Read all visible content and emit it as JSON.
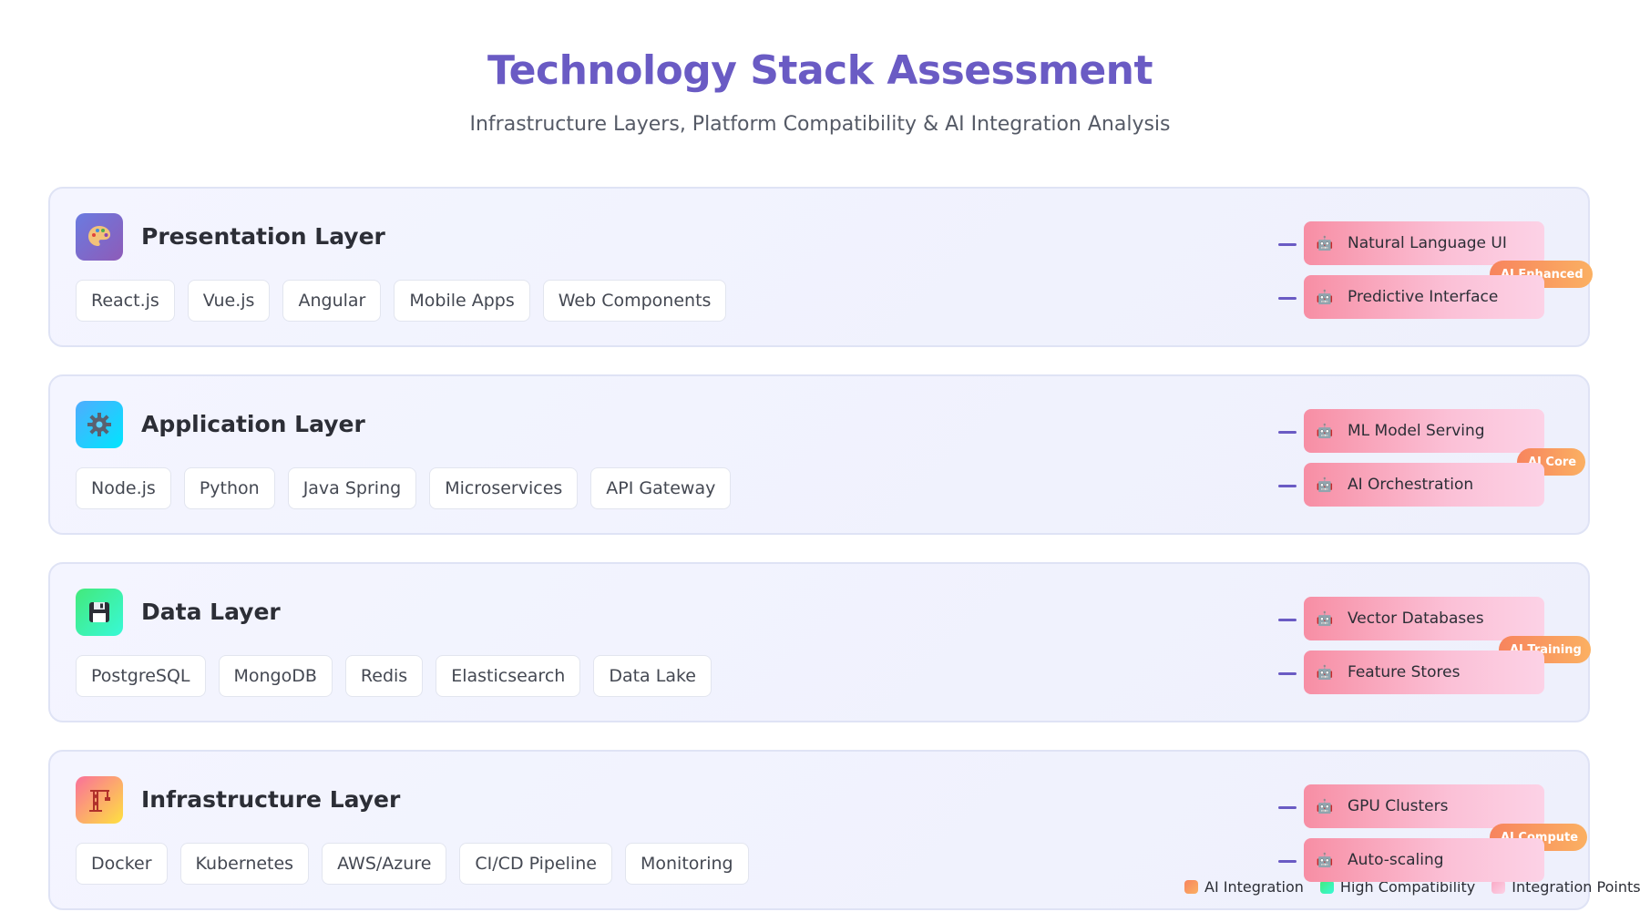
{
  "header": {
    "title": "Technology Stack Assessment",
    "subtitle": "Infrastructure Layers, Platform Compatibility & AI Integration Analysis"
  },
  "layers": [
    {
      "title": "Presentation Layer",
      "icon": "palette-icon",
      "icon_colors": [
        "#6a7be0",
        "#8e5bb8"
      ],
      "techs": [
        "React.js",
        "Vue.js",
        "Angular",
        "Mobile Apps",
        "Web Components"
      ],
      "ai_items": [
        "Natural Language UI",
        "Predictive Interface"
      ],
      "ai_badge": "AI Enhanced"
    },
    {
      "title": "Application Layer",
      "icon": "gear-icon",
      "icon_colors": [
        "#4facfe",
        "#00f2fe"
      ],
      "techs": [
        "Node.js",
        "Python",
        "Java Spring",
        "Microservices",
        "API Gateway"
      ],
      "ai_items": [
        "ML Model Serving",
        "AI Orchestration"
      ],
      "ai_badge": "AI Core"
    },
    {
      "title": "Data Layer",
      "icon": "floppy-disk-icon",
      "icon_colors": [
        "#43e97b",
        "#38f9d7"
      ],
      "techs": [
        "PostgreSQL",
        "MongoDB",
        "Redis",
        "Elasticsearch",
        "Data Lake"
      ],
      "ai_items": [
        "Vector Databases",
        "Feature Stores"
      ],
      "ai_badge": "AI Training"
    },
    {
      "title": "Infrastructure Layer",
      "icon": "crane-icon",
      "icon_colors": [
        "#fa709a",
        "#fee140"
      ],
      "techs": [
        "Docker",
        "Kubernetes",
        "AWS/Azure",
        "CI/CD Pipeline",
        "Monitoring"
      ],
      "ai_items": [
        "GPU Clusters",
        "Auto-scaling"
      ],
      "ai_badge": "AI Compute"
    }
  ],
  "legend": [
    {
      "label": "AI Integration",
      "color": "#f7845e"
    },
    {
      "label": "High Compatibility",
      "color": "#43e97b"
    },
    {
      "label": "Integration Points",
      "color": "#fbc0d6"
    }
  ],
  "ai_item_icon": "robot-icon"
}
